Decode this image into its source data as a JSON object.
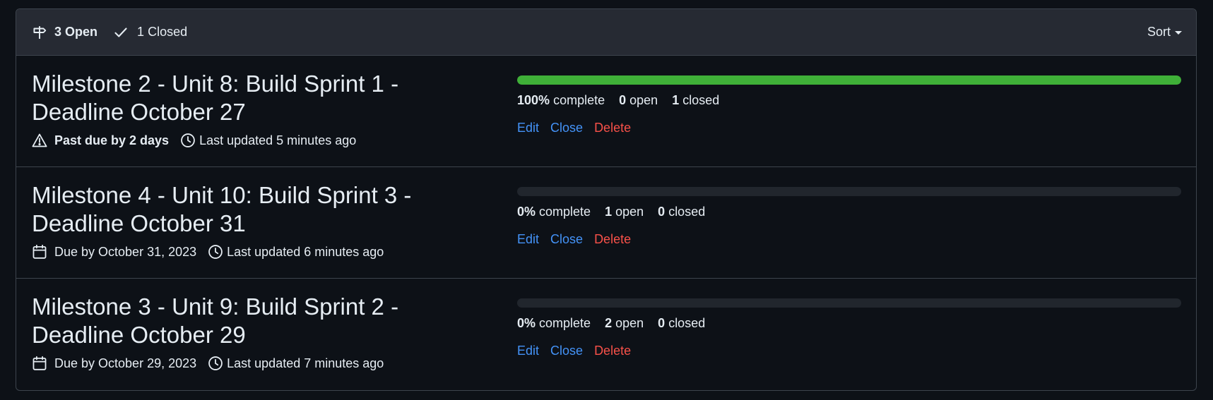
{
  "header": {
    "open_count": "3",
    "open_label": "Open",
    "closed_count": "1",
    "closed_label": "Closed",
    "sort_label": "Sort"
  },
  "milestones": [
    {
      "title": "Milestone 2 - Unit 8: Build Sprint 1 - Deadline October 27",
      "status_icon": "alert-icon",
      "status_text": "Past due by 2 days",
      "updated_text": "Last updated 5 minutes ago",
      "progress_fraction": 1.0,
      "percent": "100%",
      "complete_label": "complete",
      "open_count": "0",
      "open_label": "open",
      "closed_count": "1",
      "closed_label": "closed",
      "edit_label": "Edit",
      "close_label": "Close",
      "delete_label": "Delete"
    },
    {
      "title": "Milestone 4 - Unit 10: Build Sprint 3 - Deadline October 31",
      "status_icon": "calendar-icon",
      "status_text": "Due by October 31, 2023",
      "updated_text": "Last updated 6 minutes ago",
      "progress_fraction": 0.0,
      "percent": "0%",
      "complete_label": "complete",
      "open_count": "1",
      "open_label": "open",
      "closed_count": "0",
      "closed_label": "closed",
      "edit_label": "Edit",
      "close_label": "Close",
      "delete_label": "Delete"
    },
    {
      "title": "Milestone 3 - Unit 9: Build Sprint 2 - Deadline October 29",
      "status_icon": "calendar-icon",
      "status_text": "Due by October 29, 2023",
      "updated_text": "Last updated 7 minutes ago",
      "progress_fraction": 0.0,
      "percent": "0%",
      "complete_label": "complete",
      "open_count": "2",
      "open_label": "open",
      "closed_count": "0",
      "closed_label": "closed",
      "edit_label": "Edit",
      "close_label": "Close",
      "delete_label": "Delete"
    }
  ],
  "colors": {
    "progress_fill": "#3fb038",
    "link": "#4493f8",
    "danger": "#f85149"
  }
}
